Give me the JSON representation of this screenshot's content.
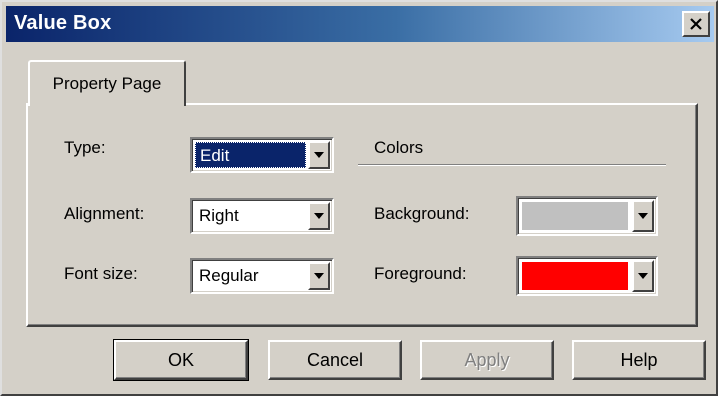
{
  "window": {
    "title": "Value Box",
    "close_icon": "close-icon"
  },
  "tabs": [
    {
      "label": "Property Page",
      "active": true
    }
  ],
  "fields": {
    "type": {
      "label": "Type:",
      "value": "Edit"
    },
    "alignment": {
      "label": "Alignment:",
      "value": "Right"
    },
    "font_size": {
      "label": "Font size:",
      "value": "Regular"
    }
  },
  "colors_group": {
    "title": "Colors",
    "background": {
      "label": "Background:",
      "color": "#c0c0c0"
    },
    "foreground": {
      "label": "Foreground:",
      "color": "#ff0000"
    }
  },
  "buttons": {
    "ok": "OK",
    "cancel": "Cancel",
    "apply": "Apply",
    "help": "Help"
  },
  "theme": {
    "face": "#d4d0c8",
    "title_gradient_start": "#0a246a",
    "selection": "#0a246a"
  }
}
